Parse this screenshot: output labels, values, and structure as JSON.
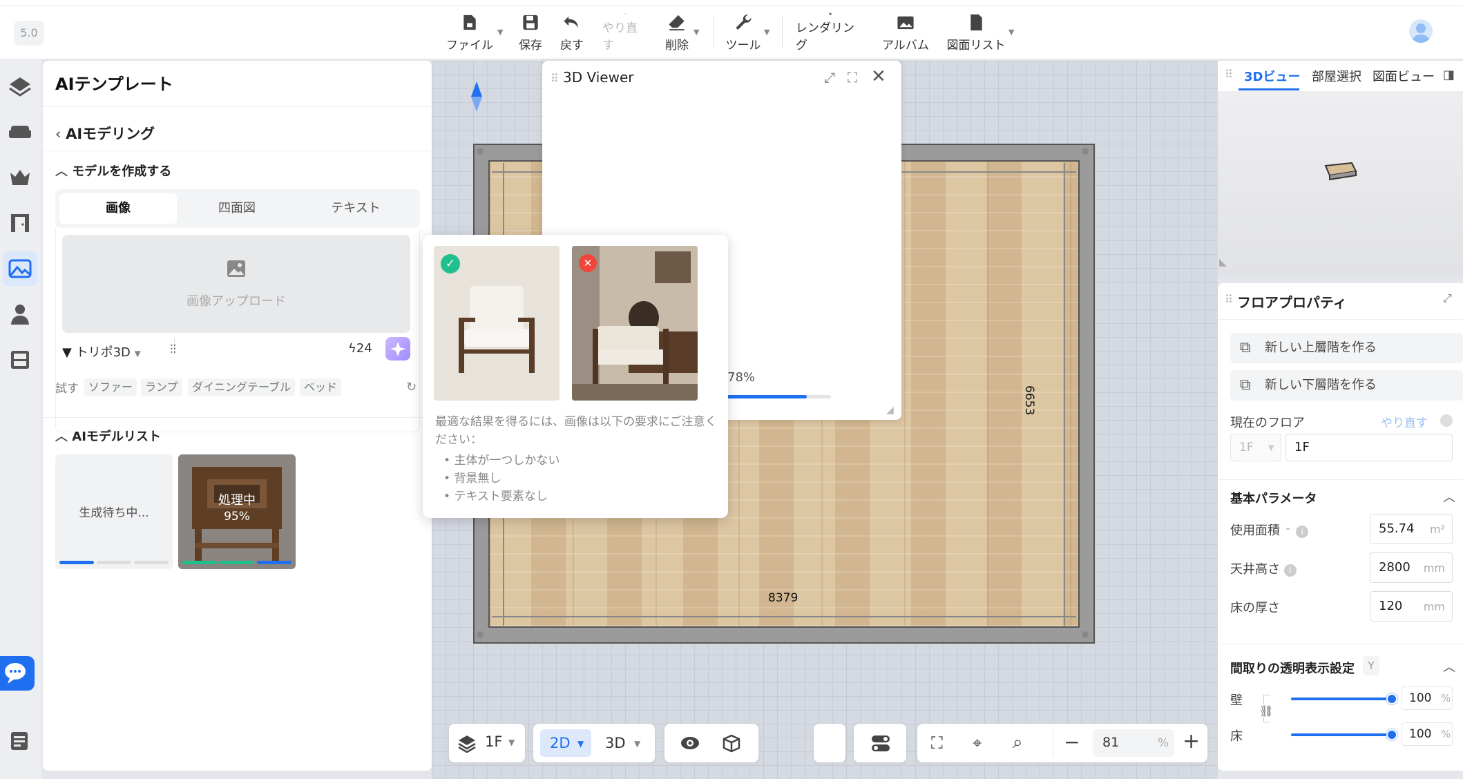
{
  "app": {
    "version": "5.0"
  },
  "toolbar": {
    "file": "ファイル",
    "save": "保存",
    "undo": "戻す",
    "redo": "やり直す",
    "delete": "削除",
    "tools": "ツール",
    "render": "レンダリング",
    "album": "アルバム",
    "plan_list": "図面リスト"
  },
  "left_panel": {
    "title": "AIテンプレート",
    "back_label": "AIモデリング",
    "create_section": "モデルを作成する",
    "tabs": [
      "画像",
      "四面図",
      "テキスト"
    ],
    "active_tab": "画像",
    "upload_label": "画像アップロード",
    "model_select": "トリポ3D",
    "credits": "24",
    "try_label": "試す",
    "try_chips": [
      "ソファー",
      "ランプ",
      "ダイニングテーブル",
      "ベッド"
    ],
    "model_list_section": "AIモデルリスト",
    "model_cards": [
      {
        "status": "生成待ち中...",
        "progress": 0.34
      },
      {
        "status": "処理中",
        "percent": "95%",
        "progress": 0.95
      }
    ]
  },
  "viewer": {
    "title": "3D Viewer",
    "progress_text": "78%",
    "progress": 0.78
  },
  "popover": {
    "good_example": "good",
    "bad_example": "bad",
    "intro": "最適な結果を得るには、画像は以下の要求にご注意ください：",
    "rules": [
      "主体が一つしかない",
      "背景無し",
      "テキスト要素なし"
    ]
  },
  "canvas": {
    "dim_width": "8379",
    "dim_height": "6653"
  },
  "bottom": {
    "floor": "1F",
    "mode_2d": "2D",
    "mode_3d": "3D",
    "zoom": "81",
    "zoom_unit": "%"
  },
  "right_panel": {
    "view_tabs": [
      "3Dビュー",
      "部屋選択",
      "図面ビュー"
    ],
    "active_view": "3Dビュー",
    "props_title": "フロアプロパティ",
    "add_upper": "新しい上層階を作る",
    "add_lower": "新しい下層階を作る",
    "current_floor_label": "現在のフロア",
    "redo_link": "やり直す",
    "floor_select": "1F",
    "floor_name": "1F",
    "basic_params": "基本パラメータ",
    "area_label": "使用面積",
    "area_value": "55.74",
    "area_unit": "m²",
    "ceiling_label": "天井高さ",
    "ceiling_value": "2800",
    "ceiling_unit": "mm",
    "thickness_label": "床の厚さ",
    "thickness_value": "120",
    "thickness_unit": "mm",
    "transparency_label": "間取りの透明表示設定",
    "transparency_key": "Y",
    "wall_label": "壁",
    "wall_value": "100",
    "floor_label": "床",
    "floor_value": "100",
    "percent_unit": "%"
  },
  "colors": {
    "accent": "#1f6ff0",
    "success": "#1fc08e",
    "error": "#f0453a"
  }
}
